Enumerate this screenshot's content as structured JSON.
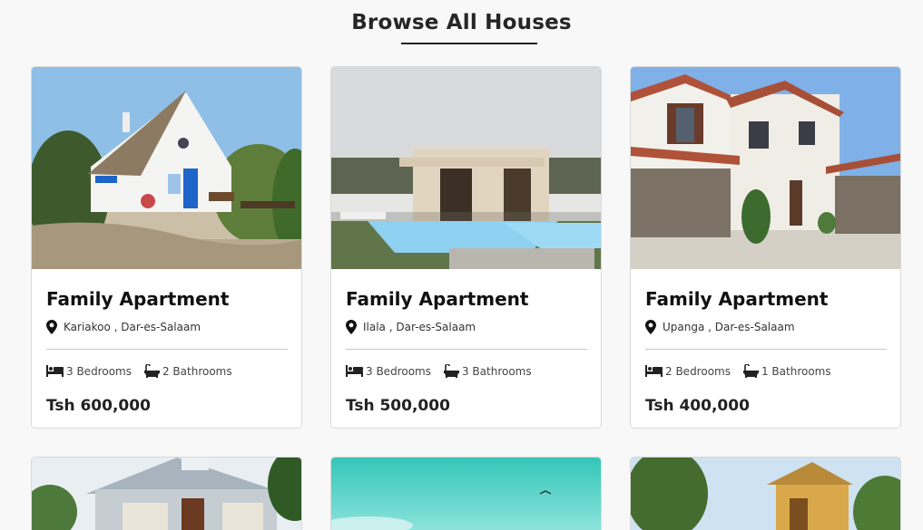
{
  "header": {
    "title": "Browse All Houses"
  },
  "listings": [
    {
      "title": "Family Apartment",
      "location": "Kariakoo , Dar-es-Salaam",
      "bedrooms": "3 Bedrooms",
      "bathrooms": "2 Bathrooms",
      "price": "Tsh 600,000"
    },
    {
      "title": "Family Apartment",
      "location": "Ilala , Dar-es-Salaam",
      "bedrooms": "3 Bedrooms",
      "bathrooms": "3 Bathrooms",
      "price": "Tsh 500,000"
    },
    {
      "title": "Family Apartment",
      "location": "Upanga , Dar-es-Salaam",
      "bedrooms": "2 Bedrooms",
      "bathrooms": "1 Bathrooms",
      "price": "Tsh 400,000"
    }
  ],
  "icons": {
    "location": "map-pin-icon",
    "bedrooms": "bed-icon",
    "bathrooms": "bathtub-icon"
  }
}
